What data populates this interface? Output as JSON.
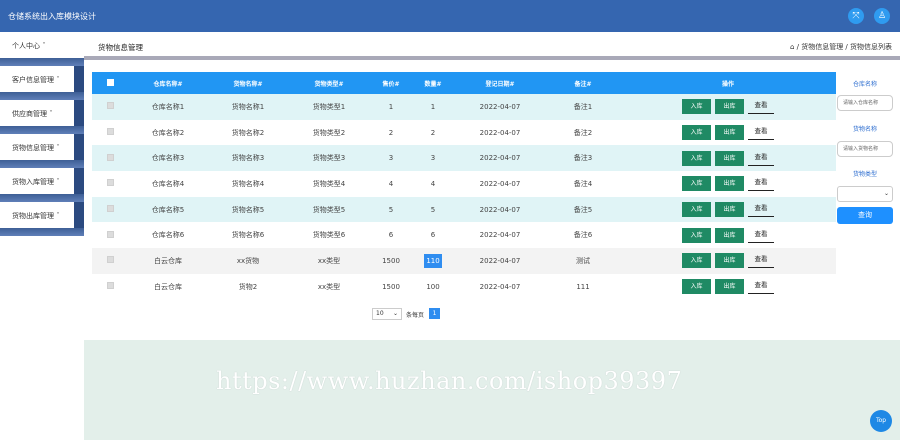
{
  "header": {
    "app_title": "仓储系统出入库模块设计",
    "icons": [
      "expand-icon",
      "user-icon"
    ],
    "expand_glyph": "⤧",
    "user_glyph": "♙"
  },
  "sidebar": {
    "items": [
      {
        "label": "个人中心"
      },
      {
        "label": "客户信息管理"
      },
      {
        "label": "供应商管理"
      },
      {
        "label": "货物信息管理"
      },
      {
        "label": "货物入库管理"
      },
      {
        "label": "货物出库管理"
      }
    ],
    "caret": "ˇ"
  },
  "page": {
    "title": "货物信息管理",
    "breadcrumb": "⌂ / 货物信息管理 / 货物信息列表"
  },
  "table": {
    "columns": [
      "仓库名称#",
      "货物名称#",
      "货物类型#",
      "售价#",
      "数量#",
      "登记日期#",
      "备注#",
      "操作"
    ],
    "rows": [
      [
        "仓库名称1",
        "货物名称1",
        "货物类型1",
        "1",
        "1",
        "2022-04-07",
        "备注1"
      ],
      [
        "仓库名称2",
        "货物名称2",
        "货物类型2",
        "2",
        "2",
        "2022-04-07",
        "备注2"
      ],
      [
        "仓库名称3",
        "货物名称3",
        "货物类型3",
        "3",
        "3",
        "2022-04-07",
        "备注3"
      ],
      [
        "仓库名称4",
        "货物名称4",
        "货物类型4",
        "4",
        "4",
        "2022-04-07",
        "备注4"
      ],
      [
        "仓库名称5",
        "货物名称5",
        "货物类型5",
        "5",
        "5",
        "2022-04-07",
        "备注5"
      ],
      [
        "仓库名称6",
        "货物名称6",
        "货物类型6",
        "6",
        "6",
        "2022-04-07",
        "备注6"
      ],
      [
        "白云仓库",
        "xx货物",
        "xx类型",
        "1500",
        "110",
        "2022-04-07",
        "测试"
      ],
      [
        "白云仓库",
        "货物2",
        "xx类型",
        "1500",
        "100",
        "2022-04-07",
        "111"
      ]
    ],
    "actions": {
      "in": "入库",
      "out": "出库",
      "view": "查看"
    }
  },
  "pager": {
    "page_size": "10",
    "text": "条每页",
    "current": "1"
  },
  "search_panel": {
    "warehouse_label": "仓库名称",
    "warehouse_placeholder": "请输入仓库名称",
    "goods_label": "货物名称",
    "goods_placeholder": "请输入货物名称",
    "type_label": "货物类型",
    "type_value": "",
    "button": "查询"
  },
  "footer": {
    "watermark": "https://www.huzhan.com/ishop39397",
    "top_button": "Top"
  },
  "colors": {
    "topbar": "#3566b0",
    "table_header": "#2196f3",
    "action_button": "#1f8a64",
    "query_button": "#1e90ff"
  }
}
